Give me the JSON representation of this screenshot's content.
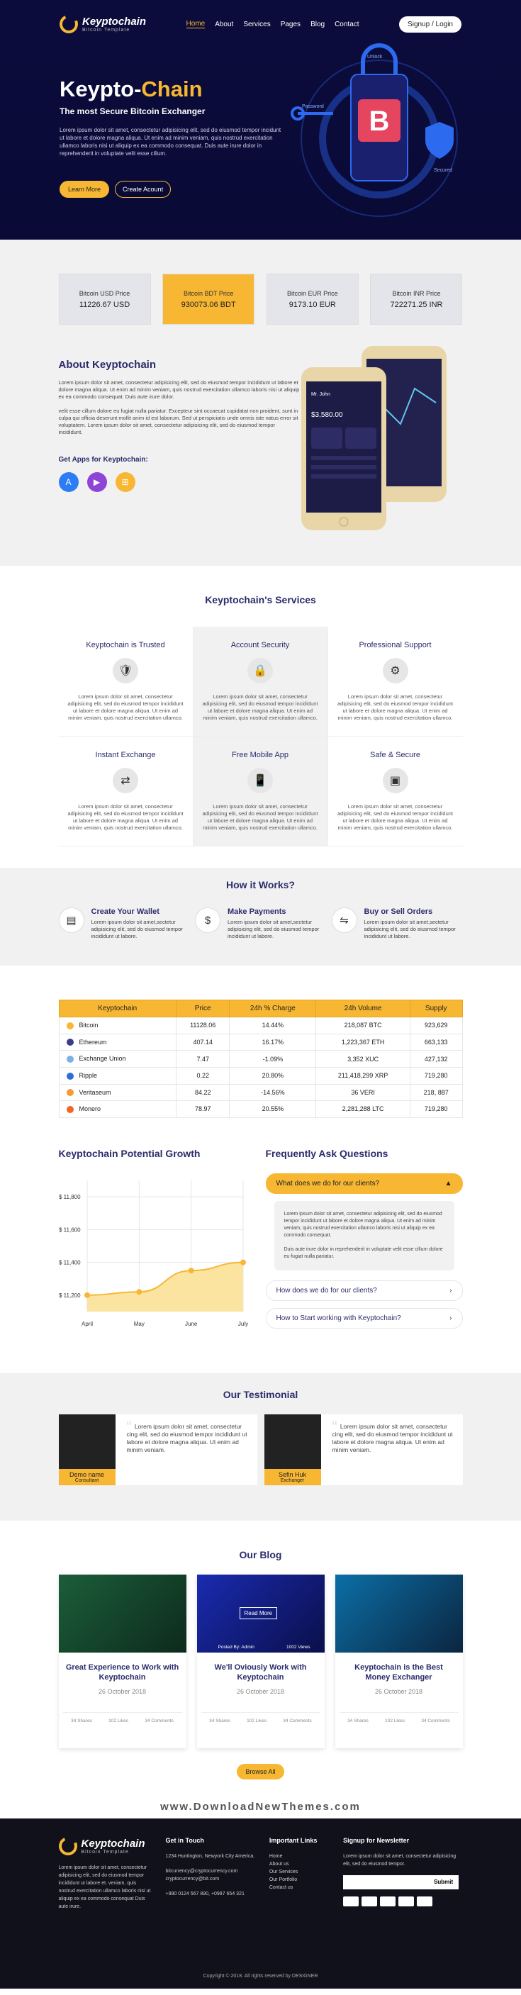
{
  "nav": {
    "logo_name": "Keyptochain",
    "logo_sub": "Bitcoin Template",
    "items": [
      "Home",
      "About",
      "Services",
      "Pages",
      "Blog",
      "Contact"
    ],
    "login": "Signup / Login"
  },
  "hero": {
    "title_a": "Keypto-",
    "title_b": "Chain",
    "subtitle": "The most Secure Bitcoin Exchanger",
    "text": "Lorem ipsum dolor sit amet, consectetur adipisicing elit, sed do eiusmod tempor incidunt ut labore et dolore magna aliqua. Ut enim ad minim veniam, quis nostrud exercitation ullamco laboris nisi ut aliquip ex ea commodo consequat. Duis aute irure dolor in reprehenderit in voluptate velit esse cillum.",
    "btn_learn": "Learn More",
    "btn_create": "Create Acount",
    "art_labels": [
      "Password",
      "Unlock",
      "Secured"
    ]
  },
  "prices": [
    {
      "label": "Bitcoin USD Price",
      "value": "11226.67 USD",
      "highlight": false
    },
    {
      "label": "Bitcoin BDT Price",
      "value": "930073.06 BDT",
      "highlight": true
    },
    {
      "label": "Bitcoin EUR Price",
      "value": "9173.10 EUR",
      "highlight": false
    },
    {
      "label": "Bitcoin INR Price",
      "value": "722271.25 INR",
      "highlight": false
    }
  ],
  "about": {
    "title": "About Keyptochain",
    "p1": "Lorem ipsum dolor sit amet, consectetur adipisicing elit, sed do eiusmod tempor incididunt ut labore et dolore magna aliqua. Ut enim ad minim veniam, quis nostrud exercitation ullamco laboris nisi ut aliquip ex ea commodo consequat. Duis aute irure dolor.",
    "p2": "velit esse cillum dolore eu fugiat nulla pariatur. Excepteur sint occaecat cupidatat non proident, sunt in culpa qui officia deserunt mollit anim id est laborum. Sed ut perspiciatis unde omnis iste natus error sit voluptatem. Lorem ipsum dolor sit amet, consectetur adipisicing elit, sed do eiusmod tempor incididunt.",
    "apps_title": "Get Apps for Keyptochain:",
    "phone_user": "Mr. John",
    "phone_balance": "$3,580.00"
  },
  "services": {
    "title": "Keyptochain's Services",
    "items": [
      {
        "title": "Keyptochain is Trusted",
        "icon": "shield-icon",
        "glyph": "🛡"
      },
      {
        "title": "Account Security",
        "icon": "lock-icon",
        "glyph": "🔒"
      },
      {
        "title": "Professional Support",
        "icon": "support-icon",
        "glyph": "⚙"
      },
      {
        "title": "Instant Exchange",
        "icon": "exchange-icon",
        "glyph": "⇄"
      },
      {
        "title": "Free Mobile App",
        "icon": "mobile-icon",
        "glyph": "📱"
      },
      {
        "title": "Safe & Secure",
        "icon": "safe-icon",
        "glyph": "▣"
      }
    ],
    "text": "Lorem ipsum dolor sit amet, consectetur adipisicing elit, sed do eiusmod tempor incididunt ut labore et dolore magna aliqua. Ut enim ad minim veniam, quis nostrud exercitation ullamco."
  },
  "how": {
    "title": "How it Works?",
    "steps": [
      {
        "title": "Create Your Wallet",
        "text": "Lorem ipsum dolor sit amet,sectetur adipisicing elit, sed do eiusmod tempor incididunt ut labore.",
        "icon": "wallet-icon",
        "glyph": "▤"
      },
      {
        "title": "Make Payments",
        "text": "Lorem ipsum dolor sit amet,sectetur adipisicing elit, sed do eiusmod tempor incididunt ut labore.",
        "icon": "money-bag-icon",
        "glyph": "$"
      },
      {
        "title": "Buy or Sell Orders",
        "text": "Lorem ipsum dolor sit amet,sectetur adipisicing elit, sed do eiusmod tempor incididunt ut labore.",
        "icon": "orders-icon",
        "glyph": "⇋"
      }
    ]
  },
  "table": {
    "headers": [
      "Keyptochain",
      "Price",
      "24h % Charge",
      "24h Volume",
      "Supply"
    ],
    "rows": [
      {
        "coin": "Bitcoin",
        "color": "#f7b733",
        "price": "11128.06",
        "change": "14.44%",
        "volume": "218,087 BTC",
        "supply": "923,629"
      },
      {
        "coin": "Ethereum",
        "color": "#3c3c8c",
        "price": "407.14",
        "change": "16.17%",
        "volume": "1,223,367 ETH",
        "supply": "663,133"
      },
      {
        "coin": "Exchange Union",
        "color": "#7bb1e6",
        "price": "7.47",
        "change": "-1.09%",
        "volume": "3,352 XUC",
        "supply": "427,132"
      },
      {
        "coin": "Ripple",
        "color": "#2a6fd6",
        "price": "0.22",
        "change": "20.80%",
        "volume": "211,418,299 XRP",
        "supply": "719,280"
      },
      {
        "coin": "Veritaseum",
        "color": "#f79a33",
        "price": "84.22",
        "change": "-14.56%",
        "volume": "36 VERI",
        "supply": "218, 887"
      },
      {
        "coin": "Monero",
        "color": "#f26522",
        "price": "78.97",
        "change": "20.55%",
        "volume": "2,281,288 LTC",
        "supply": "719,280"
      }
    ]
  },
  "growth": {
    "title": "Keyptochain Potential Growth"
  },
  "chart_data": {
    "type": "area",
    "categories": [
      "April",
      "May",
      "June",
      "July"
    ],
    "values": [
      11200,
      11220,
      11350,
      11400
    ],
    "ytick_labels": [
      "$ 11,800",
      "$ 11,600",
      "$ 11,400",
      "$ 11,200"
    ],
    "ylim": [
      11100,
      11900
    ],
    "grid": true,
    "color": "#f7b733",
    "fill": "#fbe3a0"
  },
  "faq": {
    "title": "Frequently Ask Questions",
    "q1": "What does we do for our clients?",
    "a1": "Lorem ipsum dolor sit amet, consectetur adipisicing elit, sed do eiusmod tempor incididunt ut labore et dolore magna aliqua. Ut enim ad minim veniam, quis nostrud exercitation ullamco laboris nisi ut aliquip ex ea commodo consequat.",
    "a2": "Duis aute irure dolor in reprehenderit in voluptate velit esse cillum dolore eu fugiat nulla pariatur.",
    "q2": "How does we do for our clients?",
    "q3": "How to Start  working with Keyptochain?"
  },
  "testimonial": {
    "title": "Our Testimonial",
    "items": [
      {
        "name": "Demo name",
        "role": "Consultant",
        "text": "Lorem ipsum dolor sit amet, consectetur cing elit, sed do eiusmod tempor incididunt ut labore et dolore magna aliqua. Ut enim ad minim veniam."
      },
      {
        "name": "Sefin Huk",
        "role": "Exchanger",
        "text": "Lorem ipsum dolor sit amet, consectetur cing elit, sed do eiusmod tempor incididunt ut labore et dolore magna aliqua. Ut enim ad minim veniam."
      }
    ]
  },
  "blog": {
    "title": "Our Blog",
    "posts": [
      {
        "title": "Great Experience to Work with Keyptochain",
        "date": "26 October 2018",
        "shares": "34 Shares",
        "likes": "102 Likes",
        "comments": "34 Comments",
        "overlay": ""
      },
      {
        "title": "We'll Oviously Work with Keyptochain",
        "date": "26 October 2018",
        "shares": "34 Shares",
        "likes": "102 Likes",
        "comments": "34 Comments",
        "overlay": "Read More"
      },
      {
        "title": "Keyptochain is the Best Money Exchanger",
        "date": "26 October 2018",
        "shares": "34 Shares",
        "likes": "102 Likes",
        "comments": "34 Comments",
        "overlay": ""
      }
    ],
    "posted_by": "Posted By: Admin",
    "views": "1002 Views",
    "browse": "Browse All"
  },
  "watermark": "www.DownloadNewThemes.com",
  "footer": {
    "about": "Lorem ipsum dolor sit amet, consectetur adipisicing elit, sed do eiusmod tempor incididunt ut labore et. veniam, quis nostrud exercitation ullamco laboris nisi ut aliquip ex ea commodo consequat Duis aute irure.",
    "touch_title": "Get in Touch",
    "address": "1234 Huntington, Newyork City America.",
    "email": "bitcurrency@cryptocurrency.com cryptocurrency@bit.com",
    "phone": "+990 0124 567 890, +0987 654 321",
    "links_title": "Important Links",
    "links": [
      "Home",
      "About us",
      "Our Services",
      "Our Portfolio",
      "Contact us"
    ],
    "news_title": "Signup for Newsletter",
    "news_text": "Lorem ipsum dolor sit amet, consectetur adipisicing elit, sed do eiusmod tempor.",
    "submit": "Submit",
    "copyright": "Copyright © 2018. All rights reserved by DESIGNER"
  }
}
